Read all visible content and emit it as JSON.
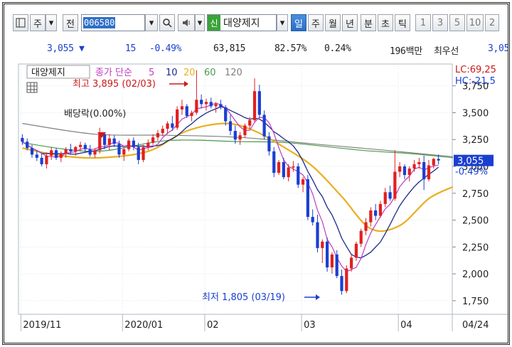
{
  "toolbar": {
    "type_label": "주",
    "jeon_label": "전",
    "code": "006580",
    "sin_tag": "신",
    "stock_name": "대양제지",
    "periods": [
      "일",
      "주",
      "월",
      "년",
      "분",
      "초",
      "틱"
    ],
    "selected_period": "일",
    "intervals": [
      "1",
      "3",
      "5",
      "10",
      "2"
    ]
  },
  "quote": {
    "price": "3,055 ▼",
    "change": "15",
    "change_pct": "-0.49%",
    "volume": "63,815",
    "vol_ratio": "82.57%",
    "turnover": "0.24%",
    "amount": "196백만",
    "priority": "최우선",
    "ask": "3,05"
  },
  "chart_data": {
    "type": "line",
    "title": "대양제지",
    "legend": {
      "price_label": "종가 단순",
      "ma_periods": [
        "5",
        "10",
        "20",
        "60",
        "120"
      ]
    },
    "x_labels": [
      "2019/11",
      "2020/01",
      "02",
      "03",
      "04",
      "04/24"
    ],
    "y_ticks": [
      1750,
      2000,
      2250,
      2500,
      2750,
      3000,
      3250,
      3500,
      3750
    ],
    "y_tick_labels": [
      "1,750",
      "2,000",
      "2,250",
      "2,500",
      "2,750",
      "3,000",
      "3,250",
      "3,500",
      "3,750"
    ],
    "ylim": [
      1650,
      3900
    ],
    "price_tag": "3,055",
    "price_tag_pct": "-0.49%",
    "lc_label": "LC:69,25",
    "hc_label": "HC:-21,5",
    "annotations": {
      "high": "최고 3,895 (02/03)",
      "low": "최저 1,805 (03/19)",
      "dividend": "배당락(0.00%)"
    },
    "colors": {
      "ma5": "#c03cc0",
      "ma10": "#1a2a8c",
      "ma20": "#e8b020",
      "ma60": "#4a9a4a",
      "ma120": "#808080",
      "up": "#e02020",
      "down": "#1a3fd0"
    },
    "candles": [
      [
        3265,
        3300,
        3200,
        3230
      ],
      [
        3230,
        3260,
        3150,
        3170
      ],
      [
        3170,
        3200,
        3080,
        3110
      ],
      [
        3110,
        3150,
        3050,
        3080
      ],
      [
        3080,
        3120,
        3000,
        3020
      ],
      [
        3020,
        3130,
        2980,
        3100
      ],
      [
        3100,
        3180,
        3060,
        3150
      ],
      [
        3150,
        3170,
        3060,
        3080
      ],
      [
        3080,
        3140,
        3040,
        3120
      ],
      [
        3120,
        3180,
        3080,
        3160
      ],
      [
        3160,
        3210,
        3110,
        3140
      ],
      [
        3140,
        3190,
        3100,
        3180
      ],
      [
        3180,
        3230,
        3140,
        3200
      ],
      [
        3200,
        3220,
        3130,
        3160
      ],
      [
        3160,
        3200,
        3090,
        3110
      ],
      [
        3110,
        3170,
        3080,
        3150
      ],
      [
        3150,
        3360,
        3120,
        3300
      ],
      [
        3300,
        3320,
        3160,
        3200
      ],
      [
        3200,
        3300,
        3150,
        3260
      ],
      [
        3260,
        3290,
        3180,
        3210
      ],
      [
        3210,
        3240,
        3080,
        3110
      ],
      [
        3110,
        3180,
        3050,
        3160
      ],
      [
        3160,
        3260,
        3140,
        3240
      ],
      [
        3240,
        3270,
        3150,
        3180
      ],
      [
        3180,
        3220,
        3020,
        3060
      ],
      [
        3060,
        3200,
        3040,
        3180
      ],
      [
        3180,
        3250,
        3150,
        3220
      ],
      [
        3220,
        3300,
        3200,
        3270
      ],
      [
        3270,
        3340,
        3240,
        3310
      ],
      [
        3310,
        3380,
        3280,
        3350
      ],
      [
        3350,
        3420,
        3300,
        3400
      ],
      [
        3400,
        3470,
        3330,
        3360
      ],
      [
        3360,
        3560,
        3340,
        3530
      ],
      [
        3530,
        3620,
        3480,
        3560
      ],
      [
        3560,
        3580,
        3450,
        3470
      ],
      [
        3470,
        3520,
        3420,
        3500
      ],
      [
        3500,
        3895,
        3480,
        3620
      ],
      [
        3620,
        3670,
        3540,
        3580
      ],
      [
        3580,
        3630,
        3520,
        3600
      ],
      [
        3600,
        3640,
        3540,
        3560
      ],
      [
        3560,
        3600,
        3500,
        3580
      ],
      [
        3580,
        3620,
        3530,
        3550
      ],
      [
        3550,
        3570,
        3380,
        3420
      ],
      [
        3420,
        3480,
        3290,
        3330
      ],
      [
        3330,
        3380,
        3210,
        3250
      ],
      [
        3250,
        3320,
        3200,
        3290
      ],
      [
        3290,
        3400,
        3270,
        3380
      ],
      [
        3380,
        3460,
        3350,
        3430
      ],
      [
        3430,
        3820,
        3410,
        3700
      ],
      [
        3700,
        3760,
        3450,
        3480
      ],
      [
        3480,
        3520,
        3250,
        3280
      ],
      [
        3280,
        3320,
        3100,
        3140
      ],
      [
        3140,
        3180,
        2900,
        2940
      ],
      [
        2940,
        3060,
        2920,
        3040
      ],
      [
        3040,
        3080,
        2880,
        2900
      ],
      [
        2900,
        3020,
        2860,
        2990
      ],
      [
        2990,
        3050,
        2950,
        3000
      ],
      [
        3000,
        3030,
        2800,
        2830
      ],
      [
        2830,
        2900,
        2760,
        2880
      ],
      [
        2880,
        2920,
        2500,
        2530
      ],
      [
        2530,
        2600,
        2450,
        2480
      ],
      [
        2480,
        2550,
        2200,
        2240
      ],
      [
        2240,
        2320,
        2100,
        2300
      ],
      [
        2300,
        2340,
        2020,
        2060
      ],
      [
        2060,
        2200,
        2000,
        2180
      ],
      [
        2180,
        2220,
        1960,
        1980
      ],
      [
        1980,
        2040,
        1805,
        1840
      ],
      [
        1840,
        2080,
        1820,
        2050
      ],
      [
        2050,
        2180,
        2020,
        2150
      ],
      [
        2150,
        2300,
        2120,
        2280
      ],
      [
        2280,
        2420,
        2250,
        2400
      ],
      [
        2400,
        2520,
        2360,
        2480
      ],
      [
        2480,
        2620,
        2440,
        2590
      ],
      [
        2590,
        2650,
        2500,
        2540
      ],
      [
        2540,
        2680,
        2520,
        2650
      ],
      [
        2650,
        2800,
        2620,
        2760
      ],
      [
        2760,
        2820,
        2680,
        2700
      ],
      [
        2700,
        3150,
        2680,
        2950
      ],
      [
        2950,
        3040,
        2900,
        3000
      ],
      [
        3000,
        3020,
        2880,
        2920
      ],
      [
        2920,
        3000,
        2860,
        2980
      ],
      [
        2980,
        3060,
        2950,
        3020
      ],
      [
        3020,
        3080,
        2980,
        3040
      ],
      [
        3040,
        3100,
        2780,
        2880
      ],
      [
        2880,
        3060,
        2860,
        3010
      ],
      [
        3010,
        3080,
        2980,
        3070
      ],
      [
        3070,
        3110,
        3020,
        3055
      ]
    ],
    "ma20_line": [
      [
        0,
        3170
      ],
      [
        8,
        3100
      ],
      [
        16,
        3080
      ],
      [
        26,
        3140
      ],
      [
        34,
        3330
      ],
      [
        42,
        3400
      ],
      [
        48,
        3330
      ],
      [
        54,
        3180
      ],
      [
        60,
        3000
      ],
      [
        66,
        2720
      ],
      [
        72,
        2420
      ],
      [
        78,
        2450
      ],
      [
        84,
        2700
      ],
      [
        89,
        2810
      ]
    ],
    "ma60_line": [
      [
        0,
        3220
      ],
      [
        15,
        3140
      ],
      [
        30,
        3240
      ],
      [
        45,
        3230
      ],
      [
        55,
        3220
      ],
      [
        70,
        3150
      ],
      [
        80,
        3120
      ],
      [
        89,
        3080
      ]
    ],
    "ma120_line": [
      [
        0,
        3400
      ],
      [
        15,
        3300
      ],
      [
        30,
        3290
      ],
      [
        45,
        3270
      ],
      [
        60,
        3210
      ],
      [
        75,
        3150
      ],
      [
        89,
        3090
      ]
    ]
  }
}
